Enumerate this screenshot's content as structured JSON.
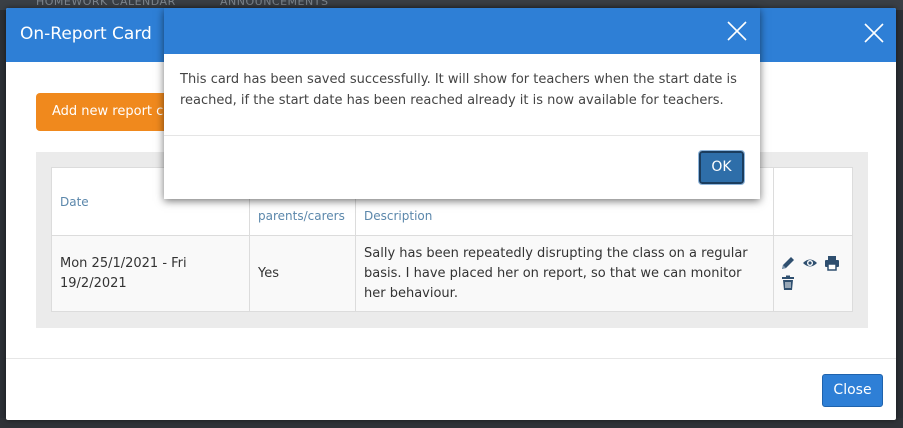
{
  "background": {
    "nav_items": [
      "HOMEWORK CALENDAR",
      "ANNOUNCEMENTS"
    ]
  },
  "modal": {
    "title": "On-Report Card",
    "close_icon": "close-icon",
    "add_button_label": "Add new report card",
    "table": {
      "headers": [
        "Date",
        "parents/carers",
        "Description",
        ""
      ],
      "rows": [
        {
          "date": "Mon 25/1/2021 - Fri 19/2/2021",
          "parents": "Yes",
          "description": "Sally has been repeatedly disrupting the class on a regular basis. I have placed her on report, so that we can monitor her behaviour.",
          "actions": [
            "pencil-icon",
            "eye-icon",
            "print-icon",
            "trash-icon"
          ]
        }
      ]
    },
    "close_button_label": "Close"
  },
  "dialog": {
    "message": "This card has been saved successfully. It will show for teachers when the start date is reached, if the start date has been reached already it is now available for teachers.",
    "ok_label": "OK"
  },
  "colors": {
    "primary": "#2e7fd6",
    "accent": "#f0891d",
    "header_text": "#5b87ab"
  }
}
